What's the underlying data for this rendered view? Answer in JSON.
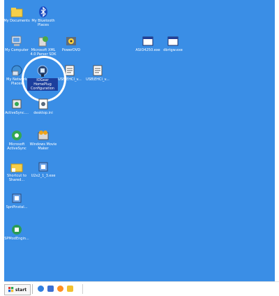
{
  "desktop": {
    "background_color": "#3a8ee6",
    "icons": [
      {
        "id": "my-documents",
        "label": "My Documents",
        "icon": "folder-icon"
      },
      {
        "id": "my-bluetooth-places",
        "label": "My Bluetooth\nPlaces",
        "icon": "bluetooth-icon"
      },
      {
        "id": "my-computer",
        "label": "My Computer",
        "icon": "computer-icon"
      },
      {
        "id": "microsoft-xml",
        "label": "Microsoft XML\n4.0 Parser SDK",
        "icon": "xml-sdk-icon"
      },
      {
        "id": "powerdvd",
        "label": "PowerDVD",
        "icon": "dvd-player-icon"
      },
      {
        "id": "asio",
        "label": "ASIO4250.exe",
        "icon": "exe-window-icon"
      },
      {
        "id": "dbtgw",
        "label": "dbrtgw.exe",
        "icon": "exe-window-icon"
      },
      {
        "id": "my-network-places",
        "label": "My Network\nPlaces",
        "icon": "network-icon"
      },
      {
        "id": "iogear",
        "label": "IOGear\nHomePlug\nConfiguration",
        "icon": "homeplug-icon",
        "selected": true
      },
      {
        "id": "usb-1",
        "label": "USB\\EHCI_v...",
        "icon": "document-icon"
      },
      {
        "id": "usb-2",
        "label": "USB\\EHCI_v...",
        "icon": "document-icon"
      },
      {
        "id": "activesync",
        "label": "ActiveSync....",
        "icon": "activesync-icon"
      },
      {
        "id": "desktop-ini",
        "label": "desktop.ini",
        "icon": "settings-file-icon"
      },
      {
        "id": "ms-activesync",
        "label": "Microsoft\nActiveSync",
        "icon": "sync-icon"
      },
      {
        "id": "windows-movie-maker",
        "label": "Windows Movie\nMaker",
        "icon": "movie-maker-icon"
      },
      {
        "id": "shortcut-shared",
        "label": "Shortcut to\nShared...",
        "icon": "shortcut-folder-icon"
      },
      {
        "id": "u2",
        "label": "U2x2_1_3.exe",
        "icon": "installer-icon"
      },
      {
        "id": "spinpinstall",
        "label": "SpnPinstal...",
        "icon": "installer-icon"
      },
      {
        "id": "spmodengin",
        "label": "SPModEngin...",
        "icon": "installer-icon"
      }
    ]
  },
  "taskbar": {
    "start_label": "start",
    "quick_launch": [
      "ie-icon",
      "outlook-icon",
      "media-player-icon",
      "folder-icon"
    ]
  }
}
